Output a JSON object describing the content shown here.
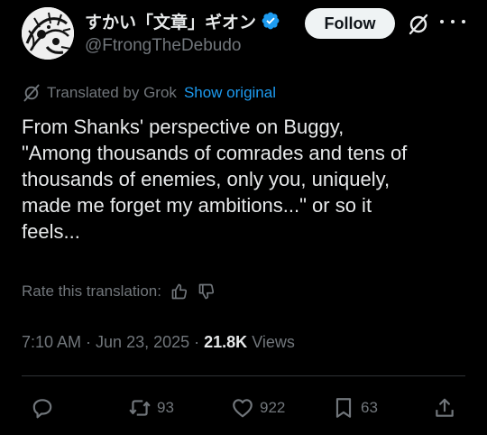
{
  "header": {
    "display_name": "すかい「文章」ギオン",
    "handle": "@FtrongTheDebudo",
    "follow_label": "Follow"
  },
  "translation": {
    "label": "Translated by Grok",
    "show_original": "Show original"
  },
  "tweet": {
    "lines": [
      "From Shanks' perspective on Buggy,",
      "\"Among thousands of comrades and tens of",
      "thousands of enemies, only you, uniquely,",
      "made me forget my ambitions...\" or so it",
      "feels..."
    ]
  },
  "rate": {
    "label": "Rate this translation:"
  },
  "meta": {
    "time": "7:10 AM",
    "separator": "·",
    "date": "Jun 23, 2025",
    "separator2": "·",
    "views_count": "21.8K",
    "views_label": "Views"
  },
  "actions": {
    "reposts": "93",
    "likes": "922",
    "bookmarks": "63"
  },
  "icons": {
    "verified": "verified-badge-icon",
    "grok": "grok-icon",
    "more": "more-icon",
    "reply": "reply-icon",
    "repost": "repost-icon",
    "like": "heart-icon",
    "bookmark": "bookmark-icon",
    "share": "share-icon",
    "thumbs_up": "thumbs-up-icon",
    "thumbs_down": "thumbs-down-icon"
  },
  "colors": {
    "background": "#000000",
    "text": "#e7e9ea",
    "muted": "#71767b",
    "link": "#1d9bf0",
    "verified": "#1d9bf0",
    "follow_bg": "#eff3f4"
  }
}
